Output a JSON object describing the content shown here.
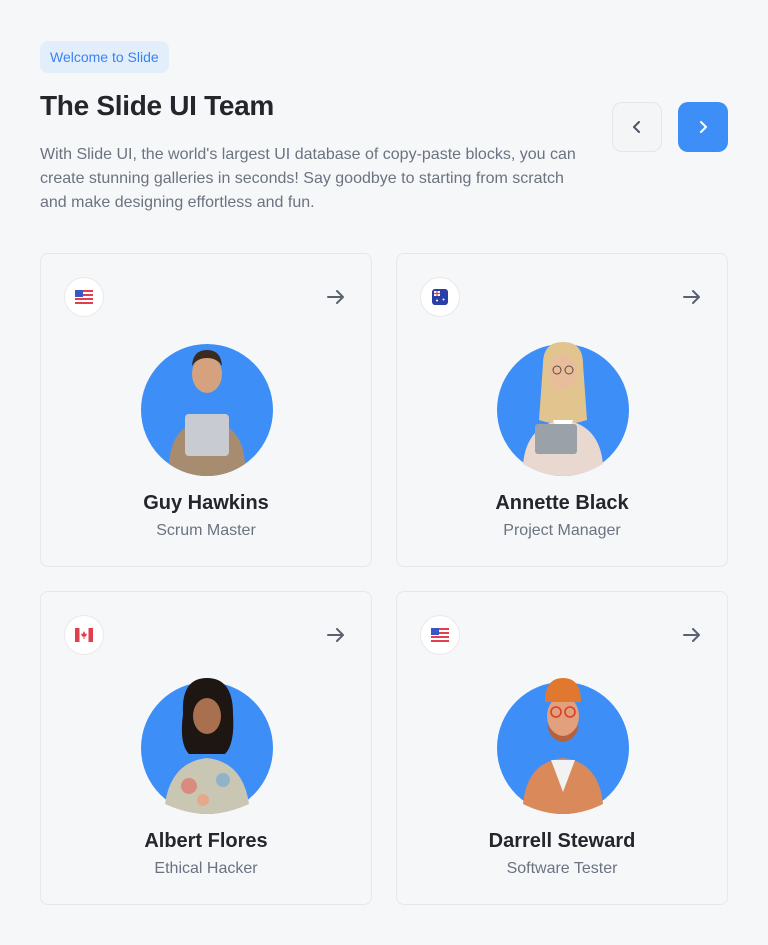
{
  "header": {
    "badge": "Welcome to Slide",
    "title": "The Slide UI Team",
    "description": "With Slide UI, the world's largest UI database of copy-paste blocks, you can create stunning galleries in seconds! Say goodbye to starting from scratch and make designing effortless and fun."
  },
  "navigation": {
    "prev_icon": "chevron-left-icon",
    "next_icon": "chevron-right-icon"
  },
  "colors": {
    "accent": "#3e8ef7",
    "badge_bg": "#e3eefb",
    "avatar_bg": "#3e8ef7"
  },
  "members": [
    {
      "name": "Guy Hawkins",
      "role": "Scrum Master",
      "flag": "us-flag-icon"
    },
    {
      "name": "Annette Black",
      "role": "Project Manager",
      "flag": "au-flag-icon"
    },
    {
      "name": "Albert Flores",
      "role": "Ethical Hacker",
      "flag": "ca-flag-icon"
    },
    {
      "name": "Darrell Steward",
      "role": "Software Tester",
      "flag": "us-flag-icon"
    }
  ]
}
